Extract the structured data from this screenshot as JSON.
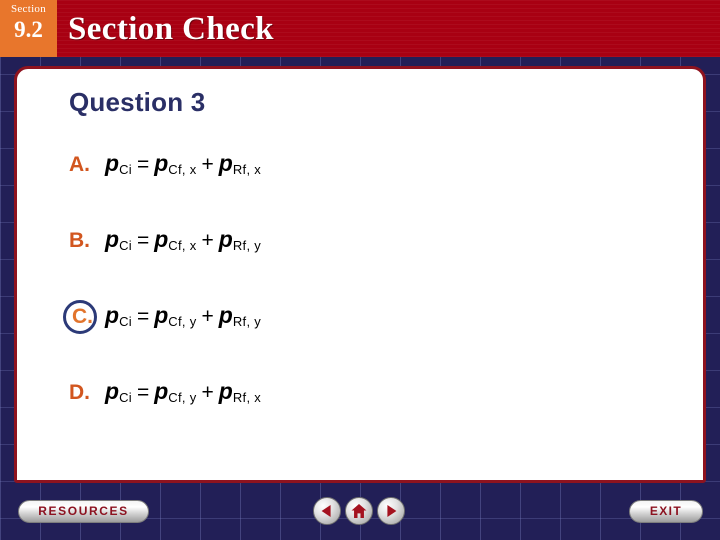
{
  "header": {
    "section_label": "Section",
    "section_number": "9.2",
    "title": "Section Check",
    "bar_color": "#a80012",
    "badge_color": "#e8762c"
  },
  "card": {
    "question_title": "Question 3",
    "border_color": "#8e131f",
    "background": "#ffffff"
  },
  "options": [
    {
      "letter": "A.",
      "selected": false,
      "lhs_var": "p",
      "lhs_sub": "Ci",
      "equals": "=",
      "term1_var": "p",
      "term1_sub": "Cf, x",
      "plus": "+",
      "term2_var": "p",
      "term2_sub": "Rf, x"
    },
    {
      "letter": "B.",
      "selected": false,
      "lhs_var": "p",
      "lhs_sub": "Ci",
      "equals": "=",
      "term1_var": "p",
      "term1_sub": "Cf, x",
      "plus": "+",
      "term2_var": "p",
      "term2_sub": "Rf, y"
    },
    {
      "letter": "C.",
      "selected": true,
      "lhs_var": "p",
      "lhs_sub": "Ci",
      "equals": "=",
      "term1_var": "p",
      "term1_sub": "Cf, y",
      "plus": "+",
      "term2_var": "p",
      "term2_sub": "Rf, y"
    },
    {
      "letter": "D.",
      "selected": false,
      "lhs_var": "p",
      "lhs_sub": "Ci",
      "equals": "=",
      "term1_var": "p",
      "term1_sub": "Cf, y",
      "plus": "+",
      "term2_var": "p",
      "term2_sub": "Rf, x"
    }
  ],
  "selection": {
    "letter_color": "#e2742c",
    "ring_color": "#2c3a78"
  },
  "footer": {
    "resources_label": "RESOURCES",
    "exit_label": "EXIT",
    "back_icon": "triangle-left-icon",
    "home_icon": "house-icon",
    "forward_icon": "triangle-right-icon"
  }
}
